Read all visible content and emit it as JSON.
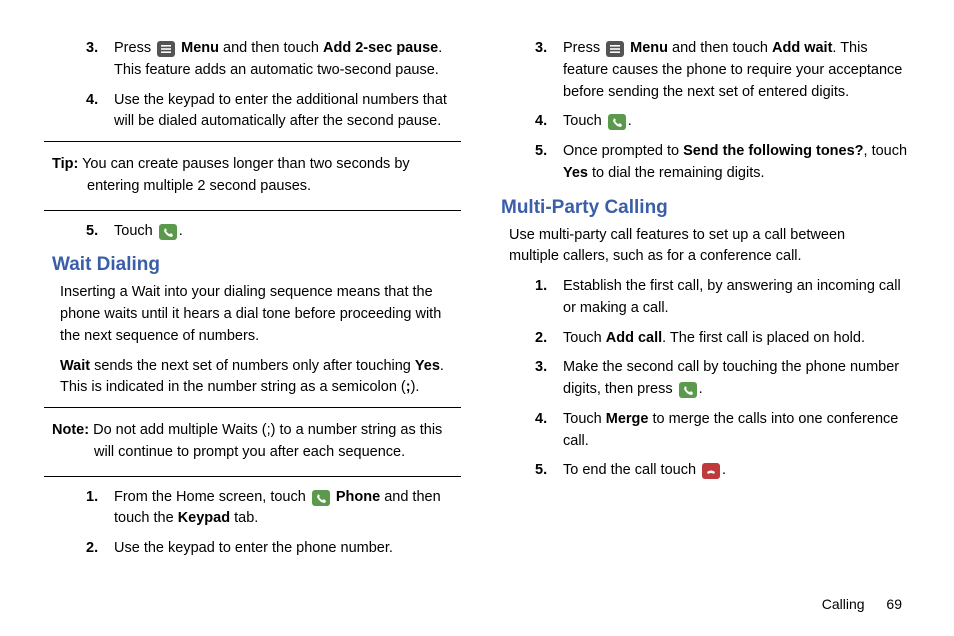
{
  "left": {
    "step3": {
      "num": "3.",
      "a": "Press ",
      "menu": "Menu",
      "b": " and then touch ",
      "add2": "Add 2-sec pause",
      "c": ". This feature adds an automatic two-second pause."
    },
    "step4": {
      "num": "4.",
      "text": "Use the keypad to enter the additional numbers that will be dialed automatically after the second pause."
    },
    "tip": {
      "label": "Tip:",
      "text": "You can create pauses longer than two seconds by",
      "cont": "entering multiple 2 second pauses."
    },
    "step5": {
      "num": "5.",
      "a": "Touch ",
      "b": "."
    },
    "waitHeading": "Wait Dialing",
    "waitP1": "Inserting a Wait into your dialing sequence means that the phone waits until it hears a dial tone before proceeding with the next sequence of numbers.",
    "waitP2a": "Wait",
    "waitP2b": " sends the next set of numbers only after touching ",
    "waitP2c": "Yes",
    "waitP2d": ". This is indicated in the number string as a semicolon (",
    "waitP2e": ";",
    "waitP2f": ").",
    "note": {
      "label": "Note:",
      "text": "Do not add multiple Waits (;) to a number string as this",
      "cont": "will continue to prompt you after each sequence."
    },
    "w1": {
      "num": "1.",
      "a": "From the Home screen, touch ",
      "phone": "Phone",
      "b": " and then touch the ",
      "keypad": "Keypad",
      "c": " tab."
    },
    "w2": {
      "num": "2.",
      "text": "Use the keypad to enter the phone number."
    }
  },
  "right": {
    "step3": {
      "num": "3.",
      "a": "Press ",
      "menu": "Menu",
      "b": " and then touch ",
      "addwait": "Add wait",
      "c": ". This feature causes the phone to require your acceptance before sending the next set of entered digits."
    },
    "step4": {
      "num": "4.",
      "a": "Touch ",
      "b": "."
    },
    "step5": {
      "num": "5.",
      "a": "Once prompted to ",
      "send": "Send the following tones?",
      "b": ", touch ",
      "yes": "Yes",
      "c": " to dial the remaining digits."
    },
    "mpcHeading": "Multi-Party Calling",
    "mpcP1": "Use multi-party call features to set up a call between multiple callers, such as for a conference call.",
    "m1": {
      "num": "1.",
      "text": "Establish the first call, by answering an incoming call or making a call."
    },
    "m2": {
      "num": "2.",
      "a": "Touch ",
      "add": "Add call",
      "b": ". The first call is placed on hold."
    },
    "m3": {
      "num": "3.",
      "a": "Make the second call by touching the phone number digits, then press ",
      "b": "."
    },
    "m4": {
      "num": "4.",
      "a": "Touch ",
      "merge": "Merge",
      "b": " to merge the calls into one conference call."
    },
    "m5": {
      "num": "5.",
      "a": "To end the call touch ",
      "b": "."
    }
  },
  "footer": {
    "section": "Calling",
    "page": "69"
  }
}
